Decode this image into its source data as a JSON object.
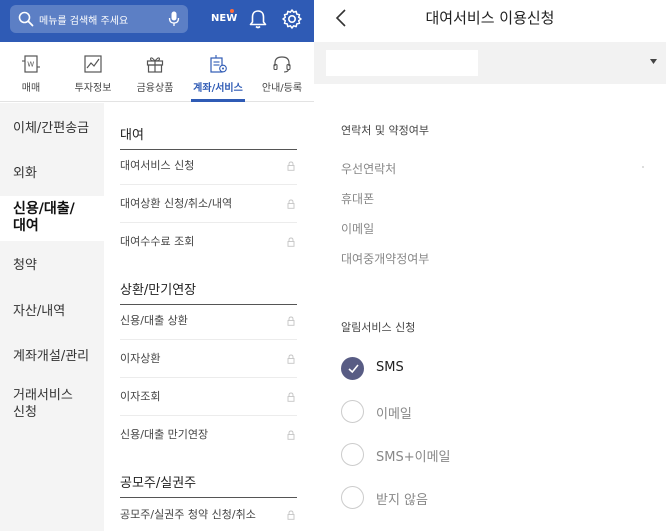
{
  "left": {
    "search": {
      "placeholder": "메뉴를 검색해 주세요",
      "icon": "search-icon",
      "mic_icon": "microphone-icon"
    },
    "topbar": {
      "new_label": "NEW",
      "bell_icon": "bell-icon",
      "gear_icon": "gear-icon",
      "color": "#2f5bb5"
    },
    "categories": [
      {
        "label": "매매",
        "icon": "trade-icon"
      },
      {
        "label": "투자정보",
        "icon": "chart-icon"
      },
      {
        "label": "금융상품",
        "icon": "gift-icon"
      },
      {
        "label": "계좌/서비스",
        "icon": "account-service-icon",
        "active": true
      },
      {
        "label": "안내/등록",
        "icon": "headset-icon"
      }
    ],
    "sidebar": [
      {
        "label": "이체/간편송금"
      },
      {
        "label": "외화"
      },
      {
        "label": "신용/대출/\n대여",
        "active": true
      },
      {
        "label": "청약"
      },
      {
        "label": "자산/내역"
      },
      {
        "label": "계좌개설/관리"
      },
      {
        "label": "거래서비스\n신청"
      }
    ],
    "sections": [
      {
        "title": "대여",
        "items": [
          "대여서비스 신청",
          "대여상환 신청/취소/내역",
          "대여수수료 조회"
        ]
      },
      {
        "title": "상환/만기연장",
        "items": [
          "신용/대출 상환",
          "이자상환",
          "이자조회",
          "신용/대출 만기연장"
        ]
      },
      {
        "title": "공모주/실권주",
        "items": [
          "공모주/실권주 청약 신청/취소"
        ]
      }
    ]
  },
  "right": {
    "title": "대여서비스 이용신청",
    "back_icon": "chevron-left-icon",
    "account_dropdown_icon": "caret-down-icon",
    "contact_section": {
      "title": "연락처 및 약정여부",
      "rows": [
        "우선연락처",
        "휴대폰",
        "이메일",
        "대여중개약정여부"
      ]
    },
    "alert_section": {
      "title": "알림서비스 신청",
      "options": [
        {
          "label": "SMS",
          "selected": true
        },
        {
          "label": "이메일",
          "selected": false
        },
        {
          "label": "SMS+이메일",
          "selected": false
        },
        {
          "label": "받지 않음",
          "selected": false
        }
      ]
    },
    "accent_color": "#585c84"
  }
}
